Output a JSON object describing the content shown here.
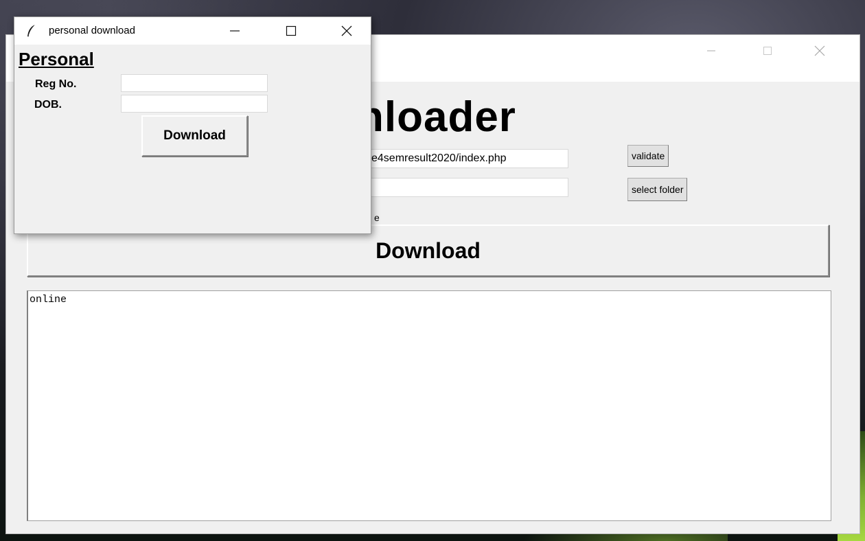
{
  "main_window": {
    "title_partial": "nloader",
    "url_value": "e4semresult2020/index.php",
    "folder_value": "",
    "validate_label": "validate",
    "select_folder_label": "select folder",
    "partial_label": "e",
    "download_label": "Download",
    "log_text": "online",
    "controls": {
      "minimize": "minimize-icon",
      "maximize": "maximize-icon",
      "close": "close-icon"
    }
  },
  "personal_window": {
    "title": "personal download",
    "icon": "feather-icon",
    "heading": "Personal",
    "reg_label": "Reg No.",
    "reg_value": "",
    "dob_label": "DOB.",
    "dob_value": "",
    "download_label": "Download"
  }
}
